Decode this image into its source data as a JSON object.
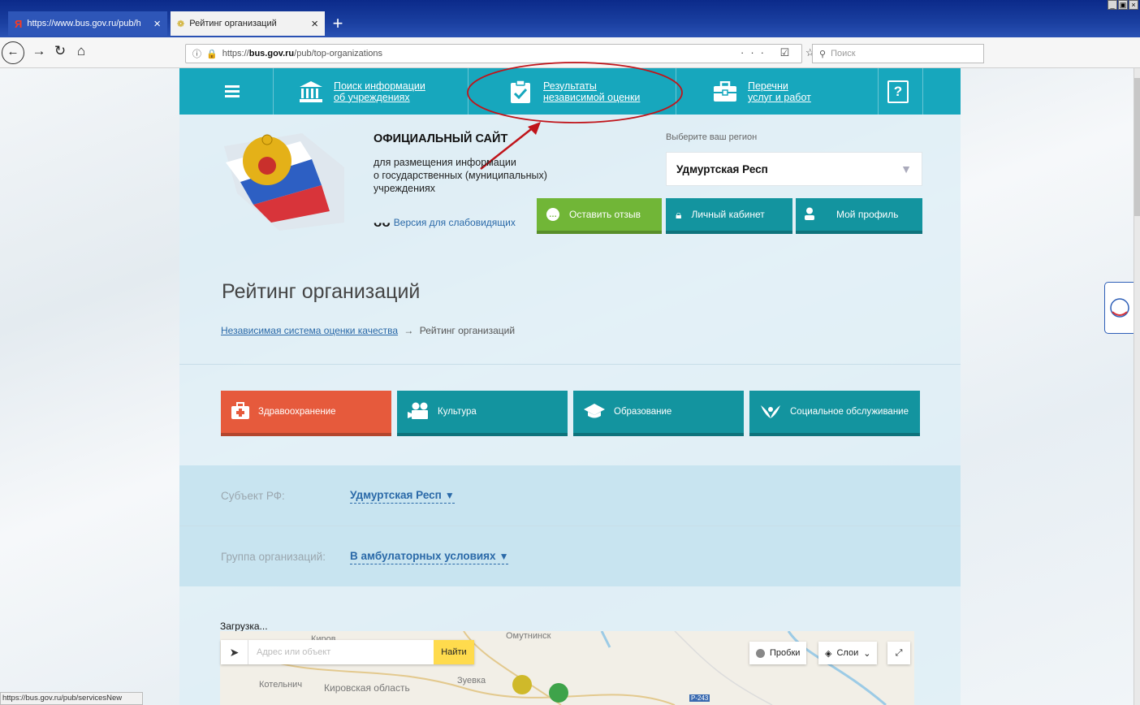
{
  "browser": {
    "tabs": [
      {
        "title": "https://www.bus.gov.ru/pub/hom",
        "active": false
      },
      {
        "title": "Рейтинг организаций",
        "active": true
      }
    ],
    "new_tab": "+",
    "url_prefix": "https://",
    "url_host": "bus.gov.ru",
    "url_path": "/pub/top-organizations",
    "url_icons": "··· ☑ ☆",
    "search_placeholder": "Поиск",
    "status_url": "https://bus.gov.ru/pub/servicesNew",
    "window_controls": [
      "_",
      "▣",
      "×"
    ],
    "nav_icons": [
      "arrow-back-icon",
      "arrow-forward-icon",
      "reload-icon",
      "home-icon",
      "library-icon",
      "sidebar-icon",
      "menu-icon"
    ]
  },
  "topnav": {
    "search_line1": "Поиск информации",
    "search_line2": "об учреждениях",
    "results_line1": "Результаты",
    "results_line2": "независимой оценки",
    "lists_line1": "Перечни",
    "lists_line2": "услуг и работ",
    "help_label": "?"
  },
  "header": {
    "title": "ОФИЦИАЛЬНЫЙ САЙТ",
    "subtitle_1": "для размещения информации",
    "subtitle_2": "о государственных (муниципальных)",
    "subtitle_3": "учреждениях",
    "vision_label": "Версия для слабовидящих",
    "region_label": "Выберите ваш регион",
    "region_value": "Удмуртская Респ",
    "feedback_label": "Оставить отзыв",
    "cabinet_label": "Личный кабинет",
    "profile_label": "Мой профиль"
  },
  "page": {
    "title": "Рейтинг организаций",
    "breadcrumb_link": "Независимая система оценки качества",
    "breadcrumb_sep": "→",
    "breadcrumb_current": "Рейтинг организаций"
  },
  "categories": {
    "health": "Здравоохранение",
    "culture": "Культура",
    "education": "Образование",
    "social": "Социальное обслуживание"
  },
  "filters": {
    "subject_label": "Субъект РФ:",
    "subject_value": "Удмуртская Респ",
    "group_label": "Группа организаций:",
    "group_value": "В амбулаторных условиях"
  },
  "map": {
    "loading": "Загрузка...",
    "search_placeholder": "Адрес или объект",
    "find_button": "Найти",
    "traffic_button": "Пробки",
    "layers_button": "Слои",
    "labels": [
      "Киров",
      "Омутнинск",
      "Котельнич",
      "Кировская область",
      "Зуевка",
      "Р-243"
    ]
  },
  "colors": {
    "topnav": "#17a7bd",
    "teal_button": "#13949f",
    "green_button": "#71b637",
    "health_button": "#e65a3c",
    "link": "#2a69a8",
    "annotation": "#c0141a"
  }
}
